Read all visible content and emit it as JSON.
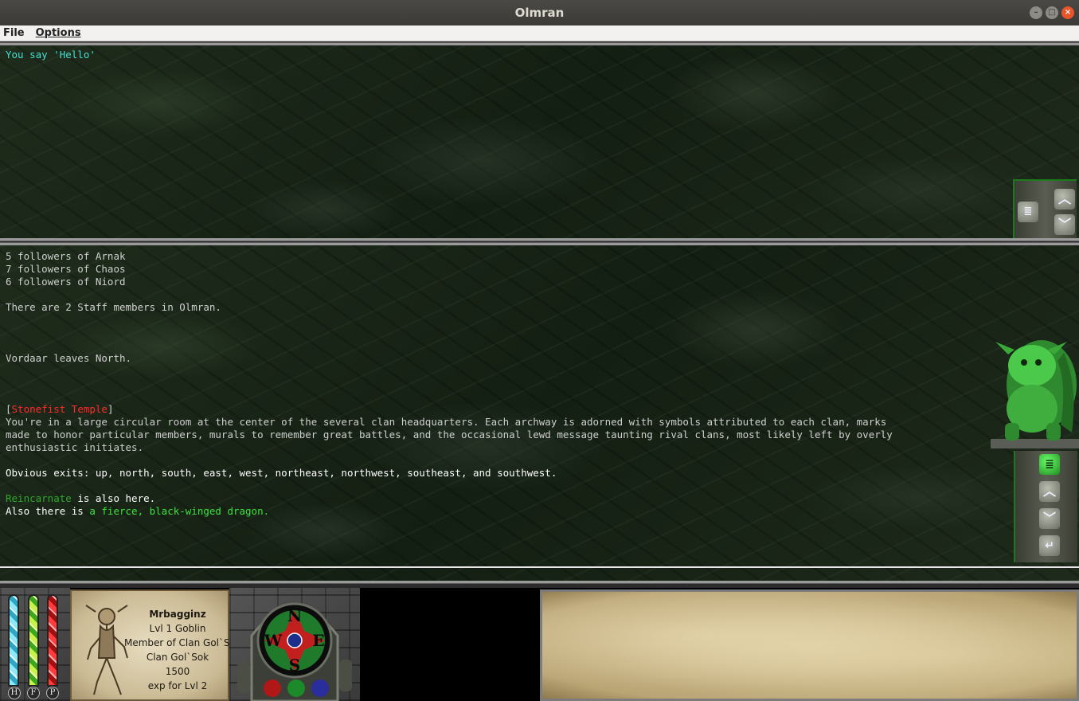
{
  "window": {
    "title": "Olmran"
  },
  "menu": {
    "file": "File",
    "options": "Options"
  },
  "top_pane": {
    "lines": [
      "You say 'Hello'"
    ]
  },
  "main_pane": {
    "followers": [
      "5 followers of Arnak",
      "7 followers of Chaos",
      "6 followers of Niord"
    ],
    "staff_line": "There are 2 Staff members in Olmran.",
    "leave_line": "Vordaar leaves North.",
    "room": {
      "open_bracket": "[",
      "name": "Stonefist Temple",
      "close_bracket": "]",
      "description": [
        "You're in a large circular room at the center of the several clan headquarters. Each archway is adorned with symbols attributed to each clan, marks",
        "made to honor particular members, murals to remember great battles, and the occasional lewd message taunting rival clans, most likely left by overly",
        "enthusiastic initiates."
      ],
      "exits_label": "Obvious exits:",
      "exits": " up, north, south, east, west, northeast, northwest, southeast, and southwest.",
      "player": "Reincarnate",
      "player_suffix": " is also here.",
      "mob_prefix": "Also there is ",
      "mob": "a fierce, black-winged dragon."
    }
  },
  "status": {
    "bars": {
      "h": "H",
      "f": "F",
      "p": "P"
    },
    "character": {
      "name": "Mrbagginz",
      "level": "Lvl 1 Goblin",
      "membership": "Member of Clan Gol`Sok",
      "clan": "Clan Gol`Sok",
      "exp": "1500",
      "exp_label": "exp for Lvl 2"
    },
    "compass": {
      "n": "N",
      "s": "S",
      "e": "E",
      "w": "W"
    }
  },
  "colors": {
    "say": "#44e0d0",
    "room_name": "#ff2a2a",
    "player": "#2fa82f",
    "mob": "#3de23d"
  }
}
